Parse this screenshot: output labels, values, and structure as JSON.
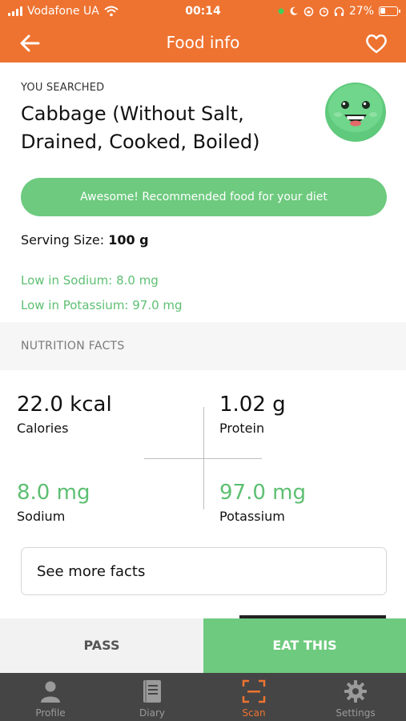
{
  "status_bar": {
    "carrier": "Vodafone UA",
    "time": "00:14",
    "battery": "27%"
  },
  "header": {
    "title": "Food info",
    "back_icon": "arrow-left-icon",
    "favorite_icon": "heart-outline-icon"
  },
  "food": {
    "searched_label": "YOU SEARCHED",
    "title": "Cabbage (Without Salt, Drained, Cooked, Boiled)",
    "mascot_icon": "happy-face-mascot-icon",
    "recommendation": "Awesome! Recommended food for your diet",
    "serving_label": "Serving Size:",
    "serving_value": "100 g",
    "badges": [
      "Low in Sodium: 8.0 mg",
      "Low in Potassium: 97.0 mg"
    ]
  },
  "nutrition": {
    "section_title": "NUTRITION FACTS",
    "facts": [
      {
        "value": "22.0 kcal",
        "label": "Calories"
      },
      {
        "value": "1.02 g",
        "label": "Protein"
      },
      {
        "value": "8.0 mg",
        "label": "Sodium"
      },
      {
        "value": "97.0 mg",
        "label": "Potassium"
      }
    ],
    "more_label": "See more facts"
  },
  "actions": {
    "pass": "PASS",
    "eat": "EAT THIS"
  },
  "tabs": [
    {
      "label": "Profile",
      "icon": "person-icon"
    },
    {
      "label": "Diary",
      "icon": "notebook-icon"
    },
    {
      "label": "Scan",
      "icon": "scan-frame-icon"
    },
    {
      "label": "Settings",
      "icon": "gear-icon"
    }
  ],
  "colors": {
    "brand_orange": "#ee7330",
    "accent_green": "#6dca7e",
    "text_green": "#5dbf72",
    "tab_bar": "#454545"
  }
}
